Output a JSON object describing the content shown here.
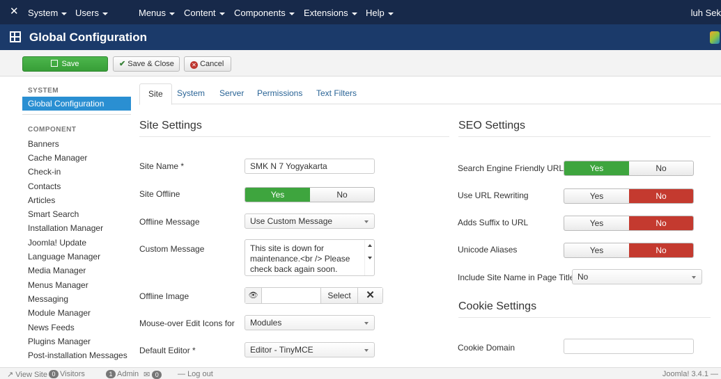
{
  "navbar": {
    "menus": [
      {
        "label": "System"
      },
      {
        "label": "Users"
      },
      {
        "label": "Menus"
      },
      {
        "label": "Content"
      },
      {
        "label": "Components"
      },
      {
        "label": "Extensions"
      },
      {
        "label": "Help"
      }
    ],
    "user": "luh Sek"
  },
  "header": {
    "title": "Global Configuration"
  },
  "toolbar": {
    "save_label": "Save",
    "save_close_label": "Save & Close",
    "cancel_label": "Cancel"
  },
  "sidebar": {
    "system_heading": "SYSTEM",
    "active_item": "Global Configuration",
    "component_heading": "COMPONENT",
    "items": [
      "Banners",
      "Cache Manager",
      "Check-in",
      "Contacts",
      "Articles",
      "Smart Search",
      "Installation Manager",
      "Joomla! Update",
      "Language Manager",
      "Media Manager",
      "Menus Manager",
      "Messaging",
      "Module Manager",
      "News Feeds",
      "Plugins Manager",
      "Post-installation Messages"
    ]
  },
  "tabs": [
    "Site",
    "System",
    "Server",
    "Permissions",
    "Text Filters"
  ],
  "site_settings": {
    "title": "Site Settings",
    "site_name_label": "Site Name *",
    "site_name_value": "SMK N 7 Yogyakarta",
    "site_offline_label": "Site Offline",
    "yes": "Yes",
    "no": "No",
    "offline_message_label": "Offline Message",
    "offline_message_value": "Use Custom Message",
    "custom_message_label": "Custom Message",
    "custom_message_value": "This site is down for maintenance.<br /> Please check back again soon.",
    "offline_image_label": "Offline Image",
    "select_label": "Select",
    "mouseover_label": "Mouse-over Edit Icons for",
    "mouseover_value": "Modules",
    "default_editor_label": "Default Editor *",
    "default_editor_value": "Editor - TinyMCE"
  },
  "seo_settings": {
    "title": "SEO Settings",
    "sef_label": "Search Engine Friendly URLs",
    "rewrite_label": "Use URL Rewriting",
    "suffix_label": "Adds Suffix to URL",
    "unicode_label": "Unicode Aliases",
    "sitename_label": "Include Site Name in Page Titles",
    "sitename_value": "No",
    "yes": "Yes",
    "no": "No"
  },
  "cookie_settings": {
    "title": "Cookie Settings",
    "domain_label": "Cookie Domain",
    "domain_value": ""
  },
  "statusbar": {
    "view_site": "View Site",
    "visitors_count": "0",
    "visitors_label": "Visitors",
    "admin_count": "1",
    "admin_label": "Admin",
    "messages_count": "0",
    "logout": "Log out",
    "version": "Joomla! 3.4.1 —"
  },
  "colors": {
    "navbar": "#17294a",
    "header": "#1b3a6a",
    "save": "#3ea53e",
    "active_red": "#c43a2f",
    "sidebar_active": "#2a8fd2"
  }
}
